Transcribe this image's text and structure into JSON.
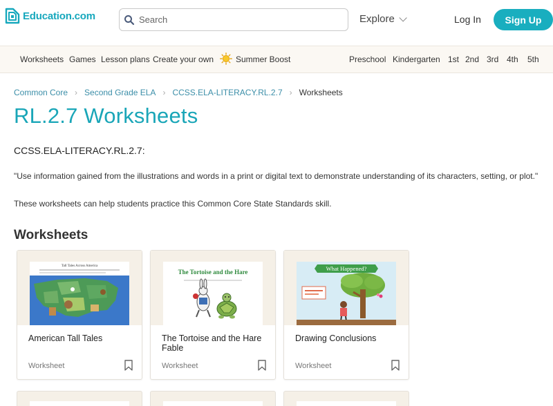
{
  "header": {
    "logo_text": "Education.com",
    "search_placeholder": "Search",
    "explore_label": "Explore",
    "login_label": "Log In",
    "signup_label": "Sign Up"
  },
  "subnav": {
    "left_items": [
      "Worksheets",
      "Games",
      "Lesson plans",
      "Create your own",
      "Summer Boost"
    ],
    "grade_items": [
      "Preschool",
      "Kindergarten",
      "1st",
      "2nd",
      "3rd",
      "4th",
      "5th"
    ]
  },
  "breadcrumb": [
    "Common Core",
    "Second Grade ELA",
    "CCSS.ELA-LITERACY.RL.2.7",
    "Worksheets"
  ],
  "page": {
    "title": "RL.2.7 Worksheets",
    "standard_code": "CCSS.ELA-LITERACY.RL.2.7:",
    "quote": "\"Use information gained from the illustrations and words in a print or digital text to demonstrate understanding of its characters, setting, or plot.\"",
    "description": "These worksheets can help students practice this Common Core State Standards skill.",
    "section_heading": "Worksheets"
  },
  "cards": [
    {
      "title": "American Tall Tales",
      "type": "Worksheet",
      "thumb_caption": "Tall Tales Across America"
    },
    {
      "title": "The Tortoise and the Hare Fable",
      "type": "Worksheet",
      "thumb_caption": "The Tortoise and the Hare"
    },
    {
      "title": "Drawing Conclusions",
      "type": "Worksheet",
      "thumb_caption": "What Happened?"
    }
  ],
  "colors": {
    "brand": "#19aebf",
    "title": "#1aa6b8",
    "link": "#3b8ea8",
    "subnav_bg": "#fbf8f3",
    "card_thumb_bg": "#f5f0e7"
  },
  "icons": [
    "logo-icon",
    "search-icon",
    "chevron-down-icon",
    "sun-icon",
    "bookmark-icon"
  ]
}
